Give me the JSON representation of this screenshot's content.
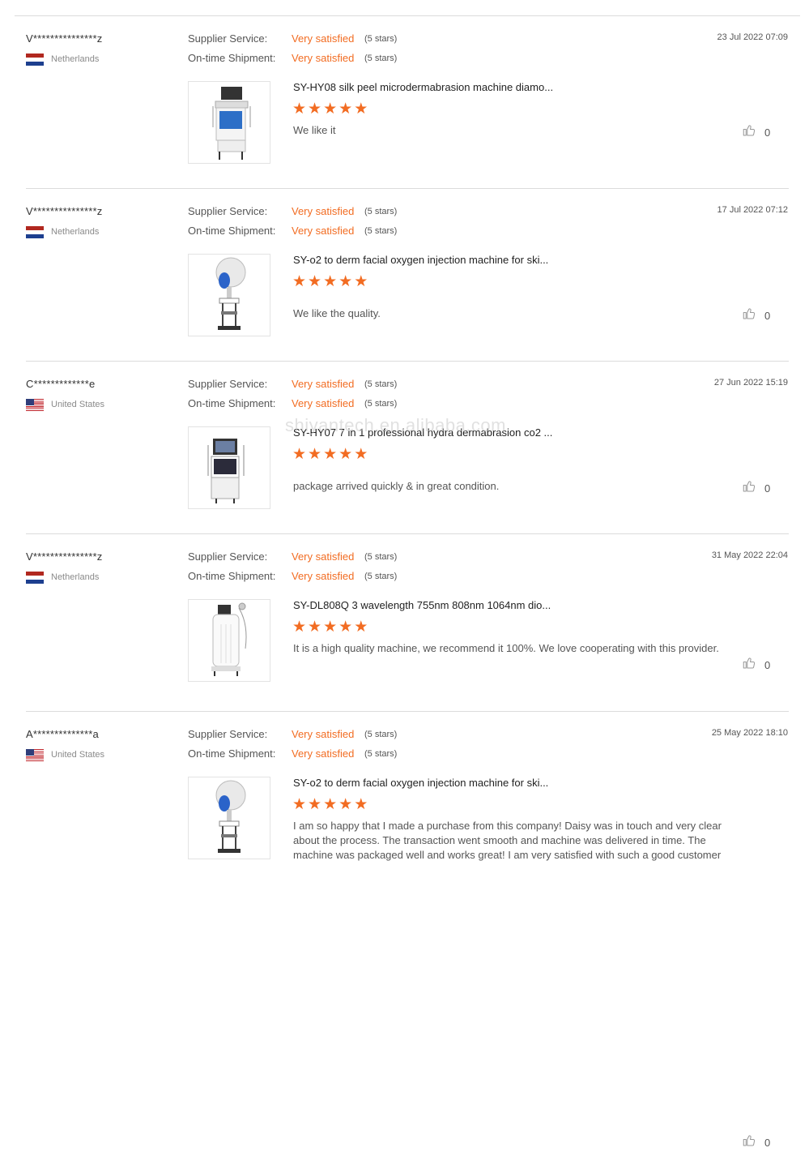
{
  "labels": {
    "supplier_service": "Supplier Service:",
    "on_time_shipment": "On-time Shipment:"
  },
  "watermark": "shiyantech.en.alibaba.com",
  "reviews": [
    {
      "buyer": "V***************z",
      "country": "Netherlands",
      "flag": "netherlands-flag",
      "date": "23 Jul 2022 07:09",
      "supplier_rating": "Very satisfied",
      "supplier_stars": "(5 stars)",
      "shipment_rating": "Very satisfied",
      "shipment_stars": "(5 stars)",
      "product_title": "SY-HY08 silk peel microdermabrasion machine diamo...",
      "product_stars": 5,
      "comment": "We like it",
      "likes": "0"
    },
    {
      "buyer": "V***************z",
      "country": "Netherlands",
      "flag": "netherlands-flag",
      "date": "17 Jul 2022 07:12",
      "supplier_rating": "Very satisfied",
      "supplier_stars": "(5 stars)",
      "shipment_rating": "Very satisfied",
      "shipment_stars": "(5 stars)",
      "product_title": "SY-o2 to derm facial oxygen injection machine for ski...",
      "product_stars": 5,
      "comment": "We like the quality.",
      "likes": "0"
    },
    {
      "buyer": "C*************e",
      "country": "United States",
      "flag": "united-states-flag",
      "date": "27 Jun 2022 15:19",
      "supplier_rating": "Very satisfied",
      "supplier_stars": "(5 stars)",
      "shipment_rating": "Very satisfied",
      "shipment_stars": "(5 stars)",
      "product_title": "SY-HY07 7 in 1 professional hydra dermabrasion co2 ...",
      "product_stars": 5,
      "comment": "package arrived quickly & in great condition.",
      "likes": "0"
    },
    {
      "buyer": "V***************z",
      "country": "Netherlands",
      "flag": "netherlands-flag",
      "date": "31 May 2022 22:04",
      "supplier_rating": "Very satisfied",
      "supplier_stars": "(5 stars)",
      "shipment_rating": "Very satisfied",
      "shipment_stars": "(5 stars)",
      "product_title": "SY-DL808Q 3 wavelength 755nm 808nm 1064nm dio...",
      "product_stars": 5,
      "comment": "It is a high quality machine, we recommend it 100%. We love cooperating with this provider.",
      "likes": "0"
    },
    {
      "buyer": "A**************a",
      "country": "United States",
      "flag": "united-states-flag",
      "date": "25 May 2022 18:10",
      "supplier_rating": "Very satisfied",
      "supplier_stars": "(5 stars)",
      "shipment_rating": "Very satisfied",
      "shipment_stars": "(5 stars)",
      "product_title": "SY-o2 to derm facial oxygen injection machine for ski...",
      "product_stars": 5,
      "comment": "I am so happy that I made a purchase from this company! Daisy was in touch and very clear about the process. The transaction went smooth and machine was delivered in time. The machine was packaged well and works great! I am very satisfied with such a good customer",
      "likes": "0"
    }
  ]
}
